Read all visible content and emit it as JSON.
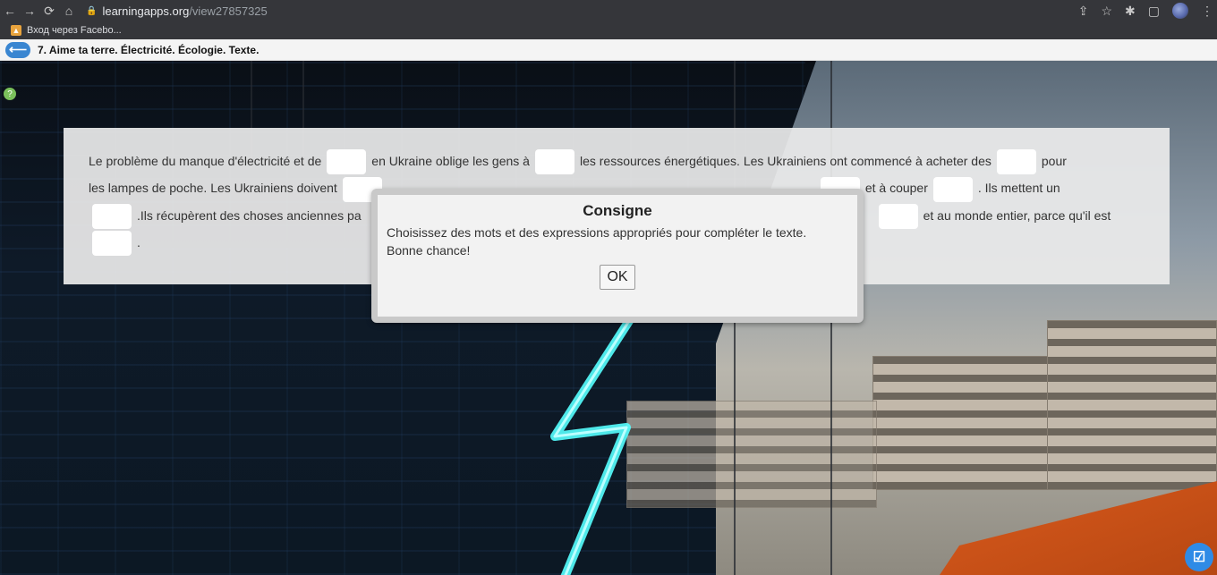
{
  "browser": {
    "url_host": "learningapps.org",
    "url_path": "/view27857325",
    "bookmark_label": "Вход через Facebo..."
  },
  "app": {
    "title": "7. Aime ta terre. Électricité. Écologie. Texte."
  },
  "exercise": {
    "line1": {
      "t1": "Le problème du manque d'électricité et de",
      "t2": "en Ukraine oblige les gens à",
      "t3": "les ressources énergétiques. Les Ukrainiens ont commencé à acheter des",
      "t4": "pour"
    },
    "line2": {
      "t1": "les lampes de poche. Les Ukrainiens doivent",
      "t2": "et à couper",
      "t3": ". Ils mettent un"
    },
    "line3": {
      "t1": ".Ils récupèrent des choses anciennes pa",
      "t2": "et au monde entier, parce qu'il est"
    },
    "line4": {
      "t1": "."
    }
  },
  "modal": {
    "title": "Consigne",
    "text1": "Choisissez des mots et des expressions appropriés pour compléter le texte.",
    "text2": "Bonne chance!",
    "ok_label": "OK"
  },
  "colors": {
    "back_button": "#3a86d1",
    "check_button": "#2f8be6"
  },
  "icons": {
    "back": "arrow-left-icon",
    "check": "check-square-icon",
    "help": "help-icon"
  }
}
